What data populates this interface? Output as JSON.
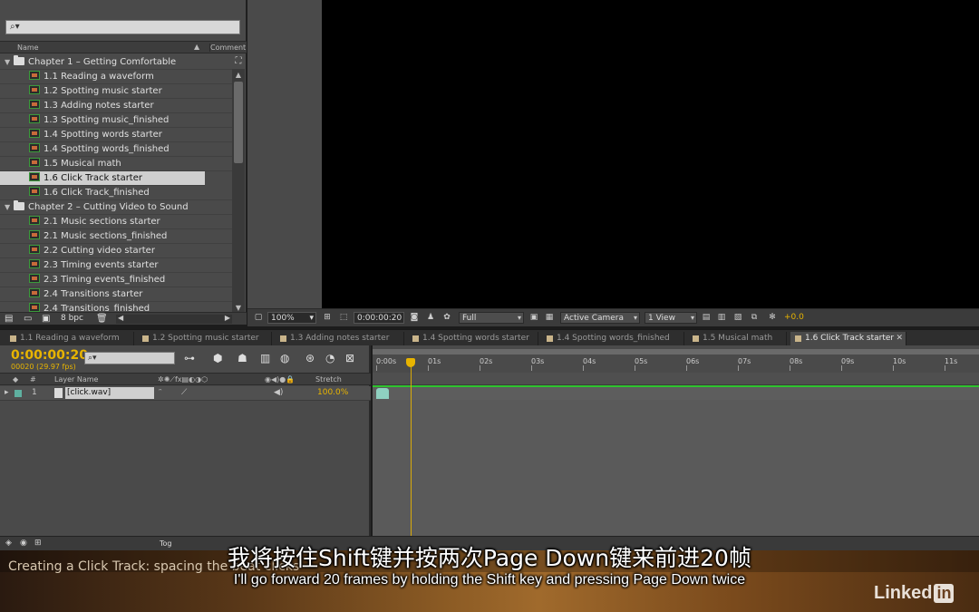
{
  "project": {
    "search_placeholder": "⌕▾",
    "col_name": "Name",
    "col_comment": "Comment",
    "rows": [
      {
        "type": "folder",
        "label": "Chapter 1 – Getting Comfortable"
      },
      {
        "type": "item",
        "label": "1.1 Reading a waveform"
      },
      {
        "type": "item",
        "label": "1.2 Spotting music starter"
      },
      {
        "type": "item",
        "label": "1.3 Adding notes starter"
      },
      {
        "type": "item",
        "label": "1.3 Spotting music_finished"
      },
      {
        "type": "item",
        "label": "1.4 Spotting words starter"
      },
      {
        "type": "item",
        "label": "1.4 Spotting words_finished"
      },
      {
        "type": "item",
        "label": "1.5 Musical math"
      },
      {
        "type": "item",
        "label": "1.6 Click Track starter",
        "selected": true
      },
      {
        "type": "item",
        "label": "1.6 Click Track_finished"
      },
      {
        "type": "folder",
        "label": "Chapter 2 – Cutting Video to Sound"
      },
      {
        "type": "item",
        "label": "2.1 Music sections starter"
      },
      {
        "type": "item",
        "label": "2.1 Music sections_finished"
      },
      {
        "type": "item",
        "label": "2.2 Cutting video starter"
      },
      {
        "type": "item",
        "label": "2.3 Timing events starter"
      },
      {
        "type": "item",
        "label": "2.3 Timing events_finished"
      },
      {
        "type": "item",
        "label": "2.4 Transitions starter"
      },
      {
        "type": "item",
        "label": "2.4 Transitions_finished"
      }
    ],
    "bpc": "8 bpc"
  },
  "viewer": {
    "zoom": "100%",
    "timecode": "0:00:00:20",
    "resolution": "Full",
    "camera": "Active Camera",
    "views": "1 View",
    "exposure": "+0.0"
  },
  "timeline": {
    "tabs": [
      {
        "label": "1.1 Reading a waveform"
      },
      {
        "label": "1.2 Spotting music starter"
      },
      {
        "label": "1.3 Adding notes starter"
      },
      {
        "label": "1.4 Spotting words starter"
      },
      {
        "label": "1.4 Spotting words_finished"
      },
      {
        "label": "1.5 Musical math"
      },
      {
        "label": "1.6 Click Track starter",
        "active": true
      }
    ],
    "timecode": "0:00:00:20",
    "frames": "00020 (29.97 fps)",
    "search_placeholder": "⌕▾",
    "header": {
      "num": "#",
      "layer_name": "Layer Name",
      "stretch": "Stretch"
    },
    "layer": {
      "index": "1",
      "name": "[click.wav]",
      "stretch": "100.0%"
    },
    "ruler_ticks": [
      "0:00s",
      "01s",
      "02s",
      "03s",
      "04s",
      "05s",
      "06s",
      "07s",
      "08s",
      "09s",
      "10s",
      "11s"
    ],
    "toggle_label": "Tog"
  },
  "footer": {
    "course_title": "Creating a Click Track: spacing the beat clicks",
    "logo_text": "Linked",
    "logo_in": "in"
  },
  "subtitles": {
    "cn": "我将按住Shift键并按两次Page Down键来前进20帧",
    "en": "I'll go forward 20 frames by holding the Shift key and pressing Page Down twice"
  },
  "colors": {
    "accent_timecode": "#e8b400",
    "track_green": "#2ec42e",
    "selection": "#cfcfcf"
  }
}
